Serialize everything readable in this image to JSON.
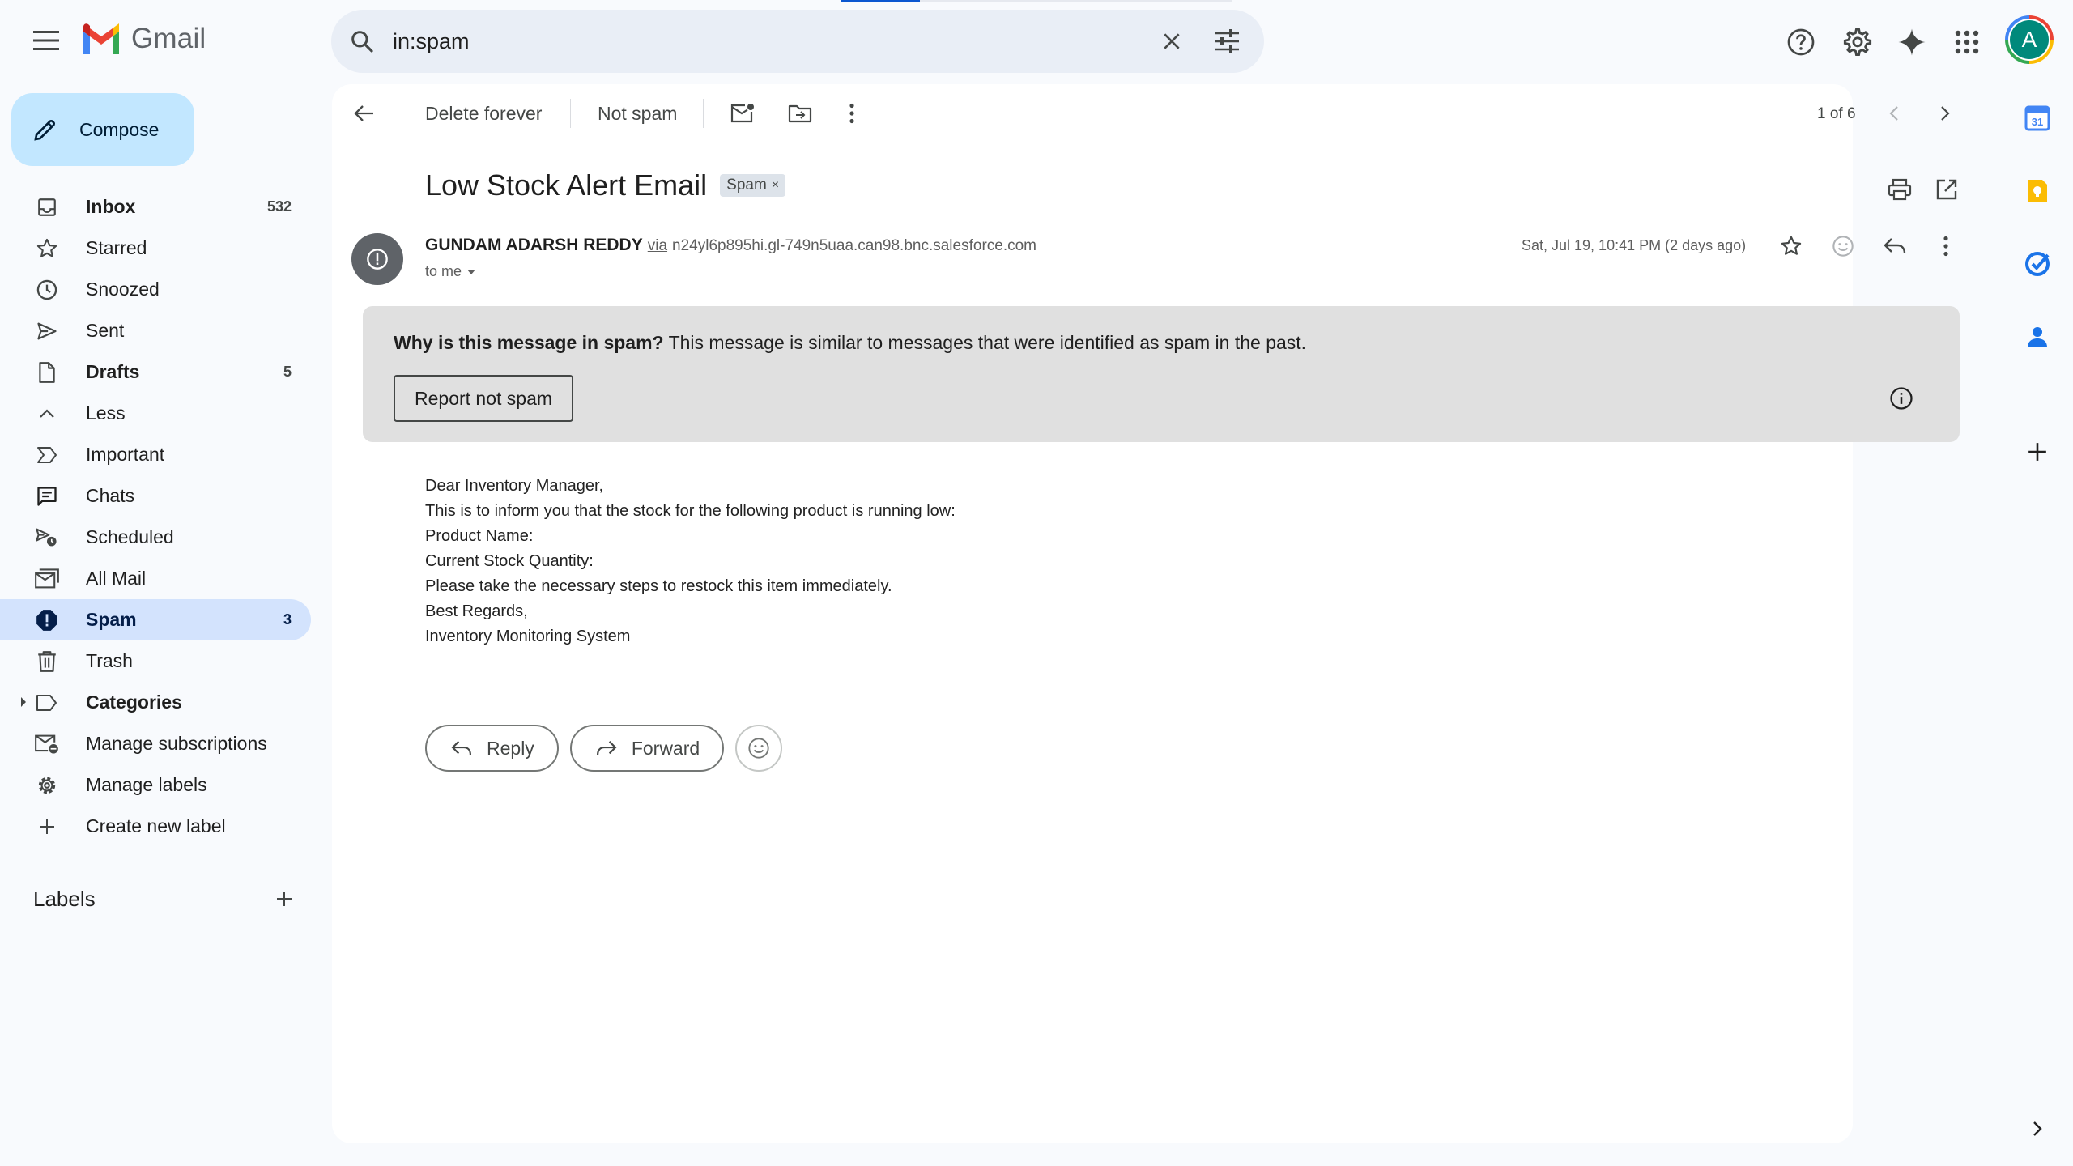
{
  "app": {
    "name": "Gmail"
  },
  "search": {
    "query": "in:spam"
  },
  "compose": {
    "label": "Compose"
  },
  "nav": [
    {
      "label": "Inbox",
      "count": "532",
      "bold": true
    },
    {
      "label": "Starred",
      "count": ""
    },
    {
      "label": "Snoozed",
      "count": ""
    },
    {
      "label": "Sent",
      "count": ""
    },
    {
      "label": "Drafts",
      "count": "5",
      "bold": true
    },
    {
      "label": "Less",
      "count": ""
    },
    {
      "label": "Important",
      "count": ""
    },
    {
      "label": "Chats",
      "count": ""
    },
    {
      "label": "Scheduled",
      "count": ""
    },
    {
      "label": "All Mail",
      "count": ""
    },
    {
      "label": "Spam",
      "count": "3",
      "active": true
    },
    {
      "label": "Trash",
      "count": ""
    },
    {
      "label": "Categories",
      "count": "",
      "bold": true
    },
    {
      "label": "Manage subscriptions",
      "count": ""
    },
    {
      "label": "Manage labels",
      "count": ""
    },
    {
      "label": "Create new label",
      "count": ""
    }
  ],
  "labels_header": "Labels",
  "toolbar": {
    "delete_forever": "Delete forever",
    "not_spam": "Not spam",
    "pagination": "1 of 6"
  },
  "message": {
    "subject": "Low Stock Alert Email",
    "chip": "Spam",
    "sender_name": "GUNDAM ADARSH REDDY",
    "via_label": "via",
    "via_domain": "n24yl6p895hi.gl-749n5uaa.can98.bnc.salesforce.com",
    "to": "to me",
    "date": "Sat, Jul 19, 10:41 PM (2 days ago)",
    "body": [
      "Dear Inventory Manager,",
      "This is to inform you that the stock for the following product is running low:",
      "Product Name:",
      "Current Stock Quantity:",
      "Please take the necessary steps to restock this item immediately.",
      "Best Regards,",
      "Inventory Monitoring System"
    ]
  },
  "spam_warning": {
    "question": "Why is this message in spam?",
    "explanation": "This message is similar to messages that were identified as spam in the past.",
    "button": "Report not spam"
  },
  "actions": {
    "reply": "Reply",
    "forward": "Forward"
  },
  "account": {
    "initial": "A"
  },
  "colors": {
    "accent": "#0b57d0",
    "compose": "#c2e7ff",
    "active_nav": "#d3e3fd",
    "avatar": "#00897b"
  }
}
